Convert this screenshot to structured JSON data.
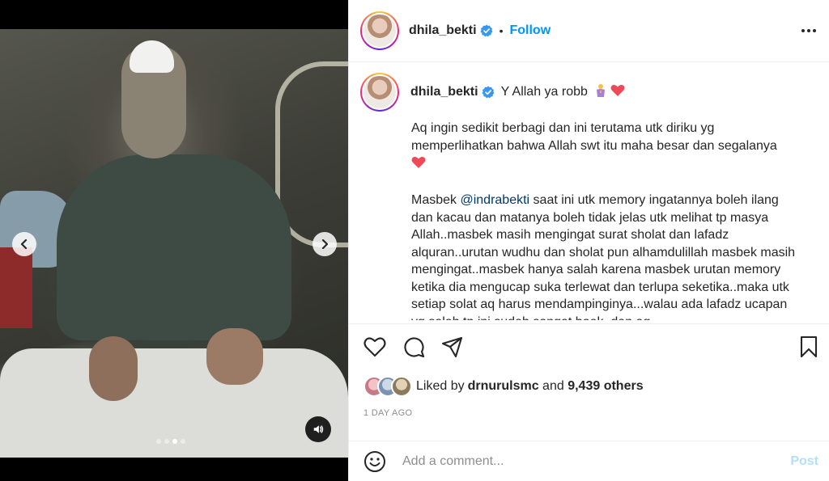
{
  "post": {
    "username": "dhila_bekti",
    "separator": "•",
    "follow_label": "Follow",
    "caption_first": "Y Allah ya robb",
    "caption_paragraph_1": "Aq ingin sedikit berbagi dan ini terutama utk diriku yg memperlihatkan bahwa Allah swt itu maha besar dan segalanya",
    "caption_p2_lead": "Masbek ",
    "caption_p2_mention": "@indrabekti",
    "caption_p2_rest": " saat ini utk memory ingatannya boleh ilang dan kacau dan matanya boleh tidak jelas utk melihat tp masya Allah..masbek masih mengingat surat sholat dan lafadz alquran..urutan wudhu dan sholat pun alhamdulillah masbek masih mengingat..masbek hanya salah karena masbek urutan memory ketika dia mengucap suka terlewat dan terlupa seketika..maka utk setiap solat aq harus mendampinginya...walau ada lafadz ucapan yg salah tp ini sudah sangat baek..dan aq",
    "liked_by_prefix": "Liked by ",
    "liked_by_user": "drnurulsmc",
    "liked_by_and": " and ",
    "liked_by_others": "9,439 others",
    "time_ago": "1 DAY AGO",
    "comment_placeholder": "Add a comment...",
    "post_label": "Post"
  },
  "media": {
    "slide_count": 4,
    "active_slide": 3
  },
  "icons": {
    "verified": "verified-badge-icon",
    "more": "more-options-icon",
    "like": "heart-outline-icon",
    "comment": "comment-bubble-icon",
    "share": "paper-plane-icon",
    "save": "bookmark-icon",
    "emoji": "smiley-icon",
    "prev": "chevron-left-icon",
    "next": "chevron-right-icon",
    "audio": "speaker-icon"
  },
  "colors": {
    "accent": "#0095f6",
    "mention": "#00376b",
    "heart": "#ed4956",
    "muted": "#8e8e8e",
    "post_disabled": "#b2dffc"
  }
}
